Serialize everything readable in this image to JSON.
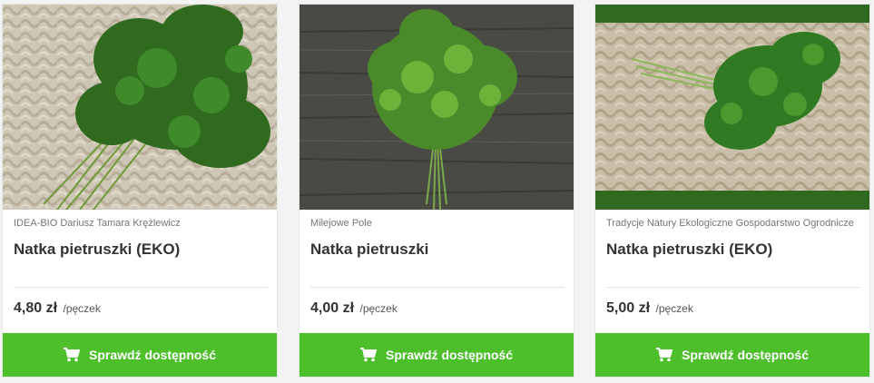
{
  "products": [
    {
      "seller": "IDEA-BIO Dariusz Tamara Krężlewicz",
      "title": "Natka pietruszki (EKO)",
      "price": "4,80 zł",
      "unit": "/pęczek",
      "cta_label": "Sprawdź dostępność",
      "image": "parsley-on-woven-mat"
    },
    {
      "seller": "Milejowe Pole",
      "title": "Natka pietruszki",
      "price": "4,00 zł",
      "unit": "/pęczek",
      "cta_label": "Sprawdź dostępność",
      "image": "parsley-on-dark-wood"
    },
    {
      "seller": "Tradycje Natury Ekologiczne Gospodarstwo Ogrodnicze",
      "title": "Natka pietruszki (EKO)",
      "price": "5,00 zł",
      "unit": "/pęczek",
      "cta_label": "Sprawdź dostępność",
      "image": "parsley-on-basket-tray"
    }
  ],
  "icons": {
    "cta": "cart-icon"
  },
  "colors": {
    "cta_bg": "#4cbf2a",
    "cta_text": "#ffffff",
    "title": "#333333",
    "seller": "#757575"
  }
}
